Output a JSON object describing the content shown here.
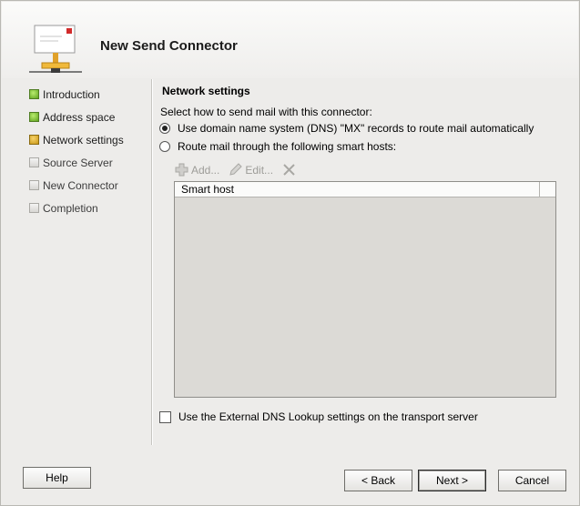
{
  "header": {
    "title": "New Send Connector"
  },
  "nav": {
    "items": [
      {
        "label": "Introduction",
        "status": "done"
      },
      {
        "label": "Address space",
        "status": "done"
      },
      {
        "label": "Network settings",
        "status": "current"
      },
      {
        "label": "Source Server",
        "status": "pending"
      },
      {
        "label": "New Connector",
        "status": "pending"
      },
      {
        "label": "Completion",
        "status": "pending"
      }
    ]
  },
  "main": {
    "section_title": "Network settings",
    "prompt": "Select how to send mail with this connector:",
    "option_dns": "Use domain name system (DNS) \"MX\" records to route mail automatically",
    "option_smarthost": "Route mail through the following smart hosts:",
    "toolbar": {
      "add_label": "Add...",
      "edit_label": "Edit..."
    },
    "list": {
      "column_header": "Smart host"
    },
    "external_dns_label": "Use the External DNS Lookup settings on the transport server"
  },
  "footer": {
    "help_label": "Help",
    "back_label": "< Back",
    "next_label": "Next >",
    "cancel_label": "Cancel"
  }
}
